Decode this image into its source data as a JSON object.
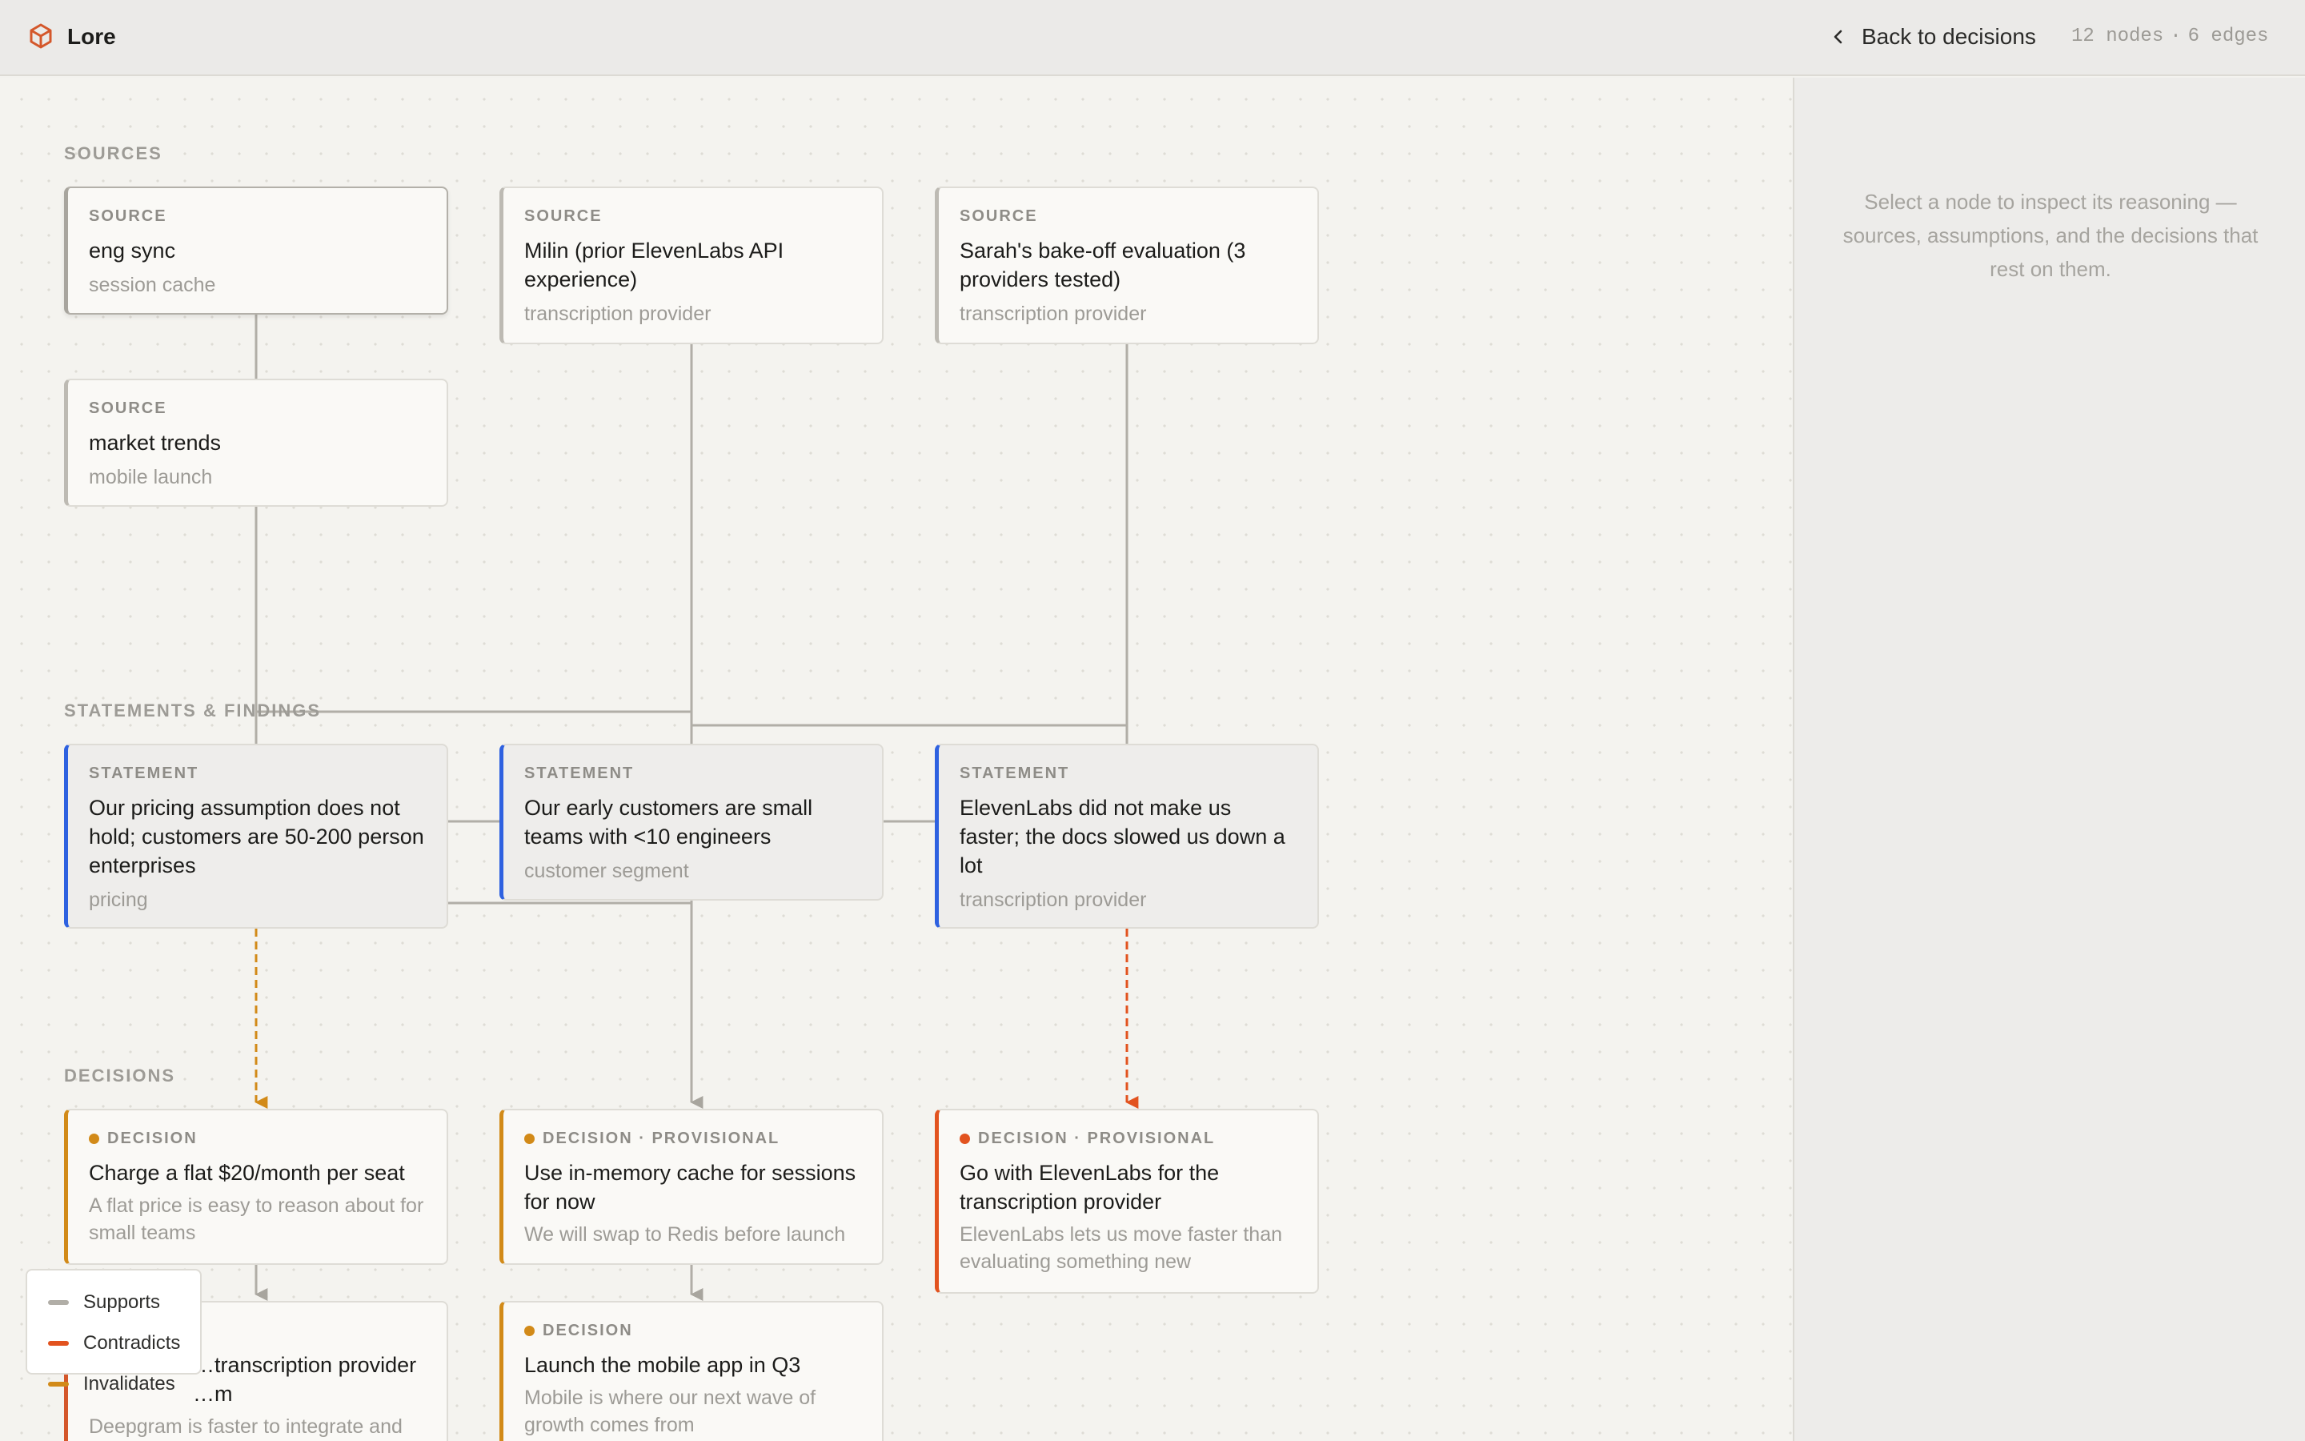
{
  "header": {
    "app_title": "Lore",
    "back_label": "Back to decisions",
    "nodes_count": "12 nodes",
    "separator": "·",
    "edges_count": "6 edges",
    "brand_color": "#d4572a"
  },
  "sections": {
    "sources": "SOURCES",
    "statements": "STATEMENTS & FINDINGS",
    "decisions": "DECISIONS"
  },
  "nodes": {
    "src_eng_sync": {
      "kind": "SOURCE",
      "title": "eng sync",
      "sub": "session cache"
    },
    "src_milin": {
      "kind": "SOURCE",
      "title": "Milin (prior ElevenLabs API experience)",
      "sub": "transcription provider"
    },
    "src_sarah": {
      "kind": "SOURCE",
      "title": "Sarah's bake-off evaluation (3 providers tested)",
      "sub": "transcription provider"
    },
    "src_market": {
      "kind": "SOURCE",
      "title": "market trends",
      "sub": "mobile launch"
    },
    "st_pricing": {
      "kind": "STATEMENT",
      "title": "Our pricing assumption does not hold; customers are 50-200 person enterprises",
      "sub": "pricing"
    },
    "st_customers": {
      "kind": "STATEMENT",
      "title": "Our early customers are small teams with <10 engineers",
      "sub": "customer segment"
    },
    "st_elevenlabs": {
      "kind": "STATEMENT",
      "title": "ElevenLabs did not make us faster; the docs slowed us down a lot",
      "sub": "transcription provider"
    },
    "dec_flat_price": {
      "kind": "DECISION",
      "title": "Charge a flat $20/month per seat",
      "sub": "A flat price is easy to reason about for small teams",
      "status_color": "#d28a18"
    },
    "dec_cache": {
      "kind": "DECISION · PROVISIONAL",
      "title": "Use in-memory cache for sessions for now",
      "sub": "We will swap to Redis before launch",
      "status_color": "#d28a18"
    },
    "dec_elevenlabs": {
      "kind": "DECISION · PROVISIONAL",
      "title": "Go with ElevenLabs for the transcription provider",
      "sub": "ElevenLabs lets us move faster than evaluating something new",
      "status_color": "#e2531f"
    },
    "dec_transcription_partial": {
      "kind": "DECISION",
      "title": "…transcription provider …m",
      "sub": "Deepgram is faster to integrate and",
      "status_color": "#d28a18"
    },
    "dec_mobile": {
      "kind": "DECISION",
      "title": "Launch the mobile app in Q3",
      "sub": "Mobile is where our next wave of growth comes from",
      "status_color": "#d28a18"
    }
  },
  "inspector": {
    "hint": "Select a node to inspect its reasoning — sources, assumptions, and the decisions that rest on them."
  },
  "legend": {
    "items": [
      {
        "label": "Supports",
        "color": "#b1aea7"
      },
      {
        "label": "Contradicts",
        "color": "#e2531f"
      },
      {
        "label": "Invalidates",
        "color": "#d28a18"
      }
    ]
  },
  "colors": {
    "statement_accent": "#2e61e0",
    "edge_neutral": "#b1aea7",
    "edge_invalidates": "#d28a18",
    "edge_contradicts": "#e2531f"
  }
}
